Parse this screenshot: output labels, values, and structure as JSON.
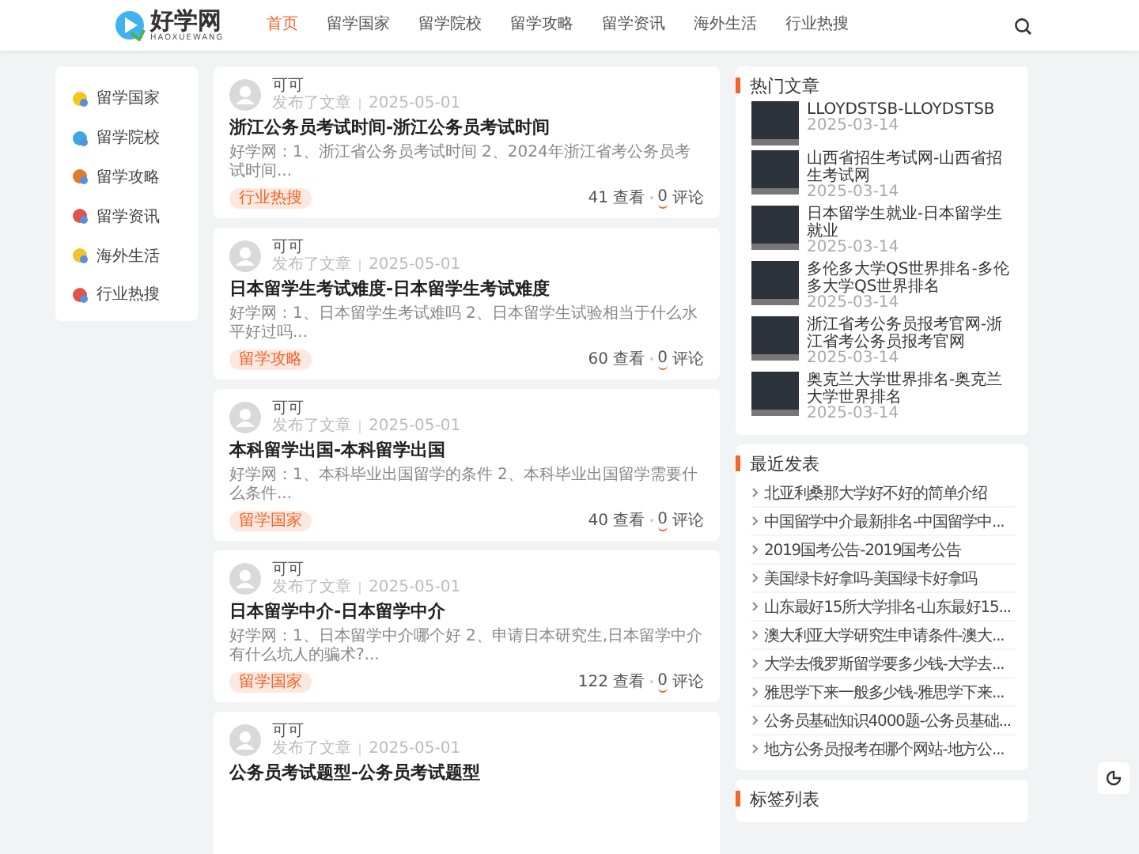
{
  "header": {
    "logo": {
      "name": "好学网",
      "subtitle": "HAOXUEWANG"
    },
    "nav": [
      {
        "label": "首页",
        "selected": true
      },
      {
        "label": "留学国家",
        "selected": false
      },
      {
        "label": "留学院校",
        "selected": false
      },
      {
        "label": "留学攻略",
        "selected": false
      },
      {
        "label": "留学资讯",
        "selected": false
      },
      {
        "label": "海外生活",
        "selected": false
      },
      {
        "label": "行业热搜",
        "selected": false
      }
    ]
  },
  "sidebar": {
    "items": [
      "留学国家",
      "留学院校",
      "留学攻略",
      "留学资讯",
      "海外生活",
      "行业热搜"
    ]
  },
  "articles": [
    {
      "author": "可可",
      "action": "发布了文章",
      "date": "2025-05-01",
      "title": "浙江公务员考试时间-浙江公务员考试时间",
      "excerpt": "好学网：1、浙江省公务员考试时间 2、2024年浙江省考公务员考试时间...",
      "tag": "行业热搜",
      "views": "41 查看",
      "comments": "0",
      "comments_label": "评论"
    },
    {
      "author": "可可",
      "action": "发布了文章",
      "date": "2025-05-01",
      "title": "日本留学生考试难度-日本留学生考试难度",
      "excerpt": "好学网：1、日本留学生考试难吗 2、日本留学生试验相当于什么水平好过吗...",
      "tag": "留学攻略",
      "views": "60 查看",
      "comments": "0",
      "comments_label": "评论"
    },
    {
      "author": "可可",
      "action": "发布了文章",
      "date": "2025-05-01",
      "title": "本科留学出国-本科留学出国",
      "excerpt": "好学网：1、本科毕业出国留学的条件 2、本科毕业出国留学需要什么条件...",
      "tag": "留学国家",
      "views": "40 查看",
      "comments": "0",
      "comments_label": "评论"
    },
    {
      "author": "可可",
      "action": "发布了文章",
      "date": "2025-05-01",
      "title": "日本留学中介-日本留学中介",
      "excerpt": "好学网：1、日本留学中介哪个好 2、申请日本研究生,日本留学中介有什么坑人的骗术?...",
      "tag": "留学国家",
      "views": "122 查看",
      "comments": "0",
      "comments_label": "评论"
    },
    {
      "author": "可可",
      "action": "发布了文章",
      "date": "2025-05-01",
      "title": "公务员考试题型-公务员考试题型"
    }
  ],
  "hot": {
    "title": "热门文章",
    "items": [
      {
        "title": "LLOYDSTSB-LLOYDSTSB",
        "date": "2025-03-14"
      },
      {
        "title": "山西省招生考试网-山西省招生考试网",
        "date": "2025-03-14"
      },
      {
        "title": "日本留学生就业-日本留学生就业",
        "date": "2025-03-14"
      },
      {
        "title": "多伦多大学QS世界排名-多伦多大学QS世界排名",
        "date": "2025-03-14"
      },
      {
        "title": "浙江省考公务员报考官网-浙江省考公务员报考官网",
        "date": "2025-03-14"
      },
      {
        "title": "奥克兰大学世界排名-奥克兰大学世界排名",
        "date": "2025-03-14"
      }
    ]
  },
  "recent": {
    "title": "最近发表",
    "items": [
      "北亚利桑那大学好不好的简单介绍",
      "中国留学中介最新排名-中国留学中...",
      "2019国考公告-2019国考公告",
      "美国绿卡好拿吗-美国绿卡好拿吗",
      "山东最好15所大学排名-山东最好15...",
      "澳大利亚大学研究生申请条件-澳大...",
      "大学去俄罗斯留学要多少钱-大学去...",
      "雅思学下来一般多少钱-雅思学下来...",
      "公务员基础知识4000题-公务员基础...",
      "地方公务员报考在哪个网站-地方公..."
    ]
  },
  "tags": {
    "title": "标签列表"
  }
}
